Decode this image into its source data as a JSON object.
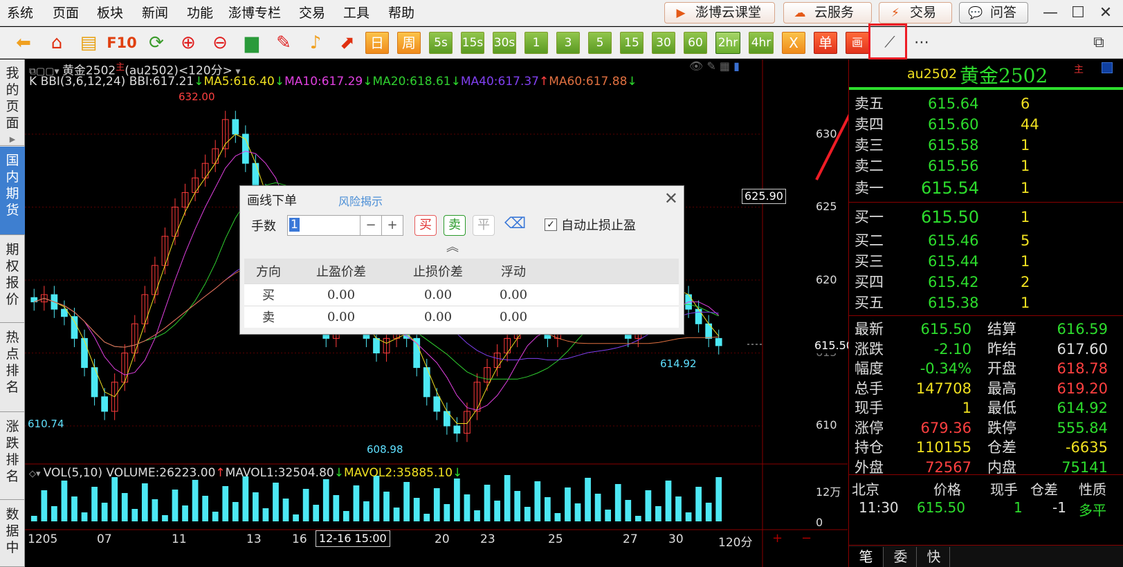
{
  "menu": [
    "系统",
    "页面",
    "板块",
    "新闻",
    "功能",
    "澎博专栏",
    "交易",
    "工具",
    "帮助"
  ],
  "top_buttons": [
    "澎博云课堂",
    "云服务",
    "交易",
    "问答"
  ],
  "toolbar": {
    "f10": "F10",
    "day": "日",
    "week": "周",
    "periods": [
      "5s",
      "15s",
      "30s",
      "1",
      "3",
      "5",
      "15",
      "30",
      "60",
      "2hr",
      "4hr"
    ],
    "x": "X",
    "single": "单",
    "draw": "画",
    "more": "⋯"
  },
  "sidetabs": [
    "我的页面",
    "国内期货",
    "期权报价",
    "热点排名",
    "涨跌排名",
    "数据中"
  ],
  "chart": {
    "title": "黄金2502",
    "title_main": "主",
    "symbol_period": "(au2502)<120分>",
    "indicator": {
      "k": "K",
      "bbi": "BBI(3,6,12,24)",
      "bbi_val": "BBI:617.21",
      "ma5": "MA5:616.40",
      "ma10": "MA10:617.29",
      "ma20": "MA20:618.61",
      "ma40": "MA40:617.37",
      "ma60": "MA60:617.88"
    },
    "price_axis": [
      "630",
      "625",
      "620",
      "615",
      "610"
    ],
    "cursor_price": "625.90",
    "last_price_tag": "615.50",
    "annotations": {
      "high": "632.00",
      "low1": "610.74",
      "low2": "608.98",
      "recent_low": "614.92"
    },
    "volume": {
      "label": "VOL(5,10)",
      "volume": "VOLUME:26223.00",
      "mavol1": "MAVOL1:32504.80",
      "mavol2": "MAVOL2:35885.10",
      "axis": [
        "12万",
        "0"
      ]
    },
    "x_axis": [
      "1205",
      "07",
      "11",
      "13",
      "16",
      "20",
      "23",
      "25",
      "27",
      "30"
    ],
    "x_cursor": "12-16 15:00",
    "period_box": "120分",
    "plus": "+",
    "minus": "−"
  },
  "dialog": {
    "title": "画线下单",
    "risk": "风险揭示",
    "lots_label": "手数",
    "lots_value": "1",
    "minus": "−",
    "plus": "+",
    "buy": "买",
    "sell": "卖",
    "flat": "平",
    "auto_label": "自动止损止盈",
    "auto_checked": true,
    "columns": [
      "方向",
      "止盈价差",
      "止损价差",
      "浮动"
    ],
    "rows": [
      [
        "买",
        "0.00",
        "0.00",
        "0.00"
      ],
      [
        "卖",
        "0.00",
        "0.00",
        "0.00"
      ]
    ]
  },
  "quote": {
    "code": "au2502",
    "name": "黄金2502",
    "main": "主",
    "asks": [
      [
        "卖五",
        "615.64",
        "6"
      ],
      [
        "卖四",
        "615.60",
        "44"
      ],
      [
        "卖三",
        "615.58",
        "1"
      ],
      [
        "卖二",
        "615.56",
        "1"
      ],
      [
        "卖一",
        "615.54",
        "1"
      ]
    ],
    "bids": [
      [
        "买一",
        "615.50",
        "1"
      ],
      [
        "买二",
        "615.46",
        "5"
      ],
      [
        "买三",
        "615.44",
        "1"
      ],
      [
        "买四",
        "615.42",
        "2"
      ],
      [
        "买五",
        "615.38",
        "1"
      ]
    ],
    "stats": [
      [
        "最新",
        "615.50",
        "结算",
        "616.59"
      ],
      [
        "涨跌",
        "-2.10",
        "昨结",
        "617.60"
      ],
      [
        "幅度",
        "-0.34%",
        "开盘",
        "618.78"
      ],
      [
        "总手",
        "147708",
        "最高",
        "619.20"
      ],
      [
        "现手",
        "1",
        "最低",
        "614.92"
      ],
      [
        "涨停",
        "679.36",
        "跌停",
        "555.84"
      ],
      [
        "持仓",
        "110155",
        "仓差",
        "-6635"
      ],
      [
        "外盘",
        "72567",
        "内盘",
        "75141"
      ]
    ],
    "tick_header": [
      "北京",
      "价格",
      "现手",
      "仓差",
      "性质"
    ],
    "tick_row": [
      "11:30",
      "615.50",
      "1",
      "-1",
      "多平"
    ],
    "bottom_tabs": [
      "笔",
      "委",
      "快"
    ]
  }
}
